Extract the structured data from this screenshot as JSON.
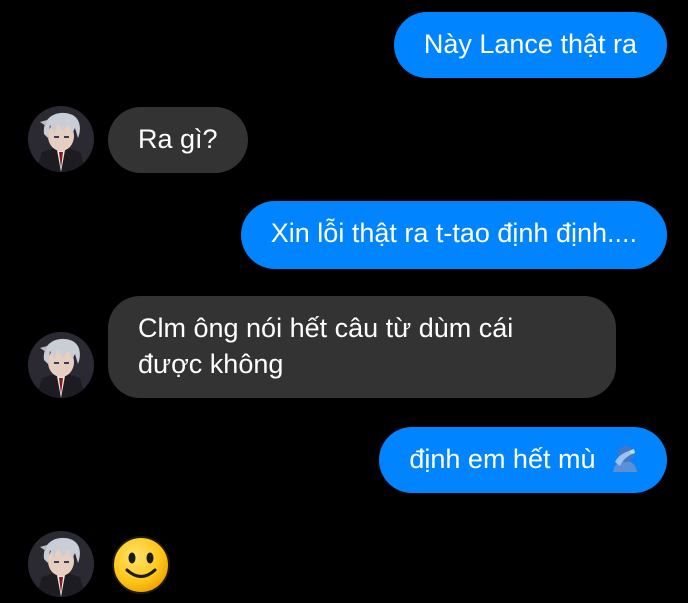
{
  "messages": [
    {
      "side": "outgoing",
      "text": "Này Lance thật ra"
    },
    {
      "side": "incoming",
      "text": "Ra gì?"
    },
    {
      "side": "outgoing",
      "text": "Xin lỗi thật ra t-tao định định...."
    },
    {
      "side": "incoming",
      "line1": "Clm ông nói hết câu từ dùm cái",
      "line2": "được không"
    },
    {
      "side": "outgoing",
      "text": "định em hết mù",
      "emoji": "person-facepalming-emoji"
    },
    {
      "side": "incoming",
      "emoji": "slightly-smiling-face-emoji"
    }
  ],
  "colors": {
    "background": "#000000",
    "outgoing_bubble": "#0084ff",
    "incoming_bubble": "#333333",
    "text": "#ffffff"
  },
  "avatar": "anime-character-avatar"
}
